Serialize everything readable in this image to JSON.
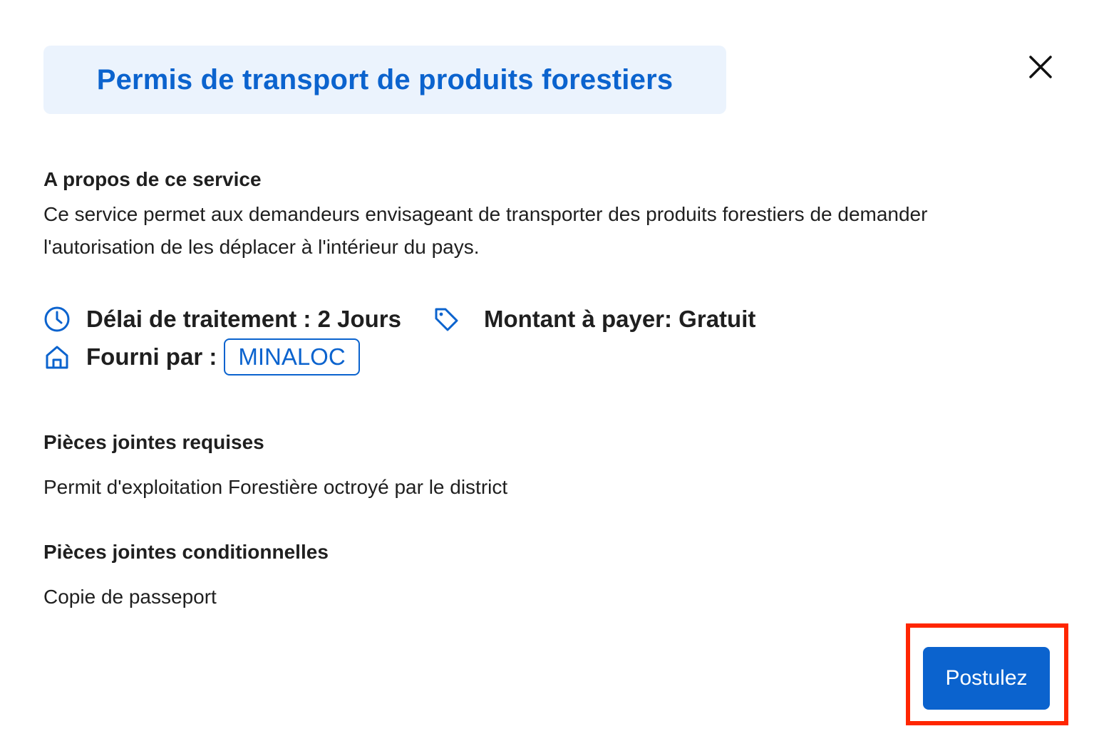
{
  "modal": {
    "title": "Permis de transport de produits forestiers",
    "close_icon": "close-icon"
  },
  "about": {
    "heading": "A propos de ce service",
    "text": "Ce service permet aux demandeurs envisageant de transporter des produits forestiers de demander l'autorisation de les déplacer à l'intérieur du pays."
  },
  "info": {
    "processing_time": "Délai de traitement : 2 Jours",
    "processing_icon": "clock-icon",
    "amount": "Montant à payer: Gratuit",
    "amount_icon": "tag-icon",
    "provider_label": "Fourni par :",
    "provider_icon": "home-icon",
    "provider_name": "MINALOC"
  },
  "attachments": {
    "required_heading": "Pièces jointes requises",
    "required_items": [
      "Permit d'exploitation Forestière octroyé par le district"
    ],
    "conditional_heading": "Pièces jointes conditionnelles",
    "conditional_items": [
      "Copie de passeport"
    ]
  },
  "actions": {
    "apply_label": "Postulez"
  },
  "colors": {
    "primary": "#0b63ce",
    "title_bg": "#ebf3fd",
    "highlight": "#ff2600",
    "text": "#1f1f1f"
  }
}
